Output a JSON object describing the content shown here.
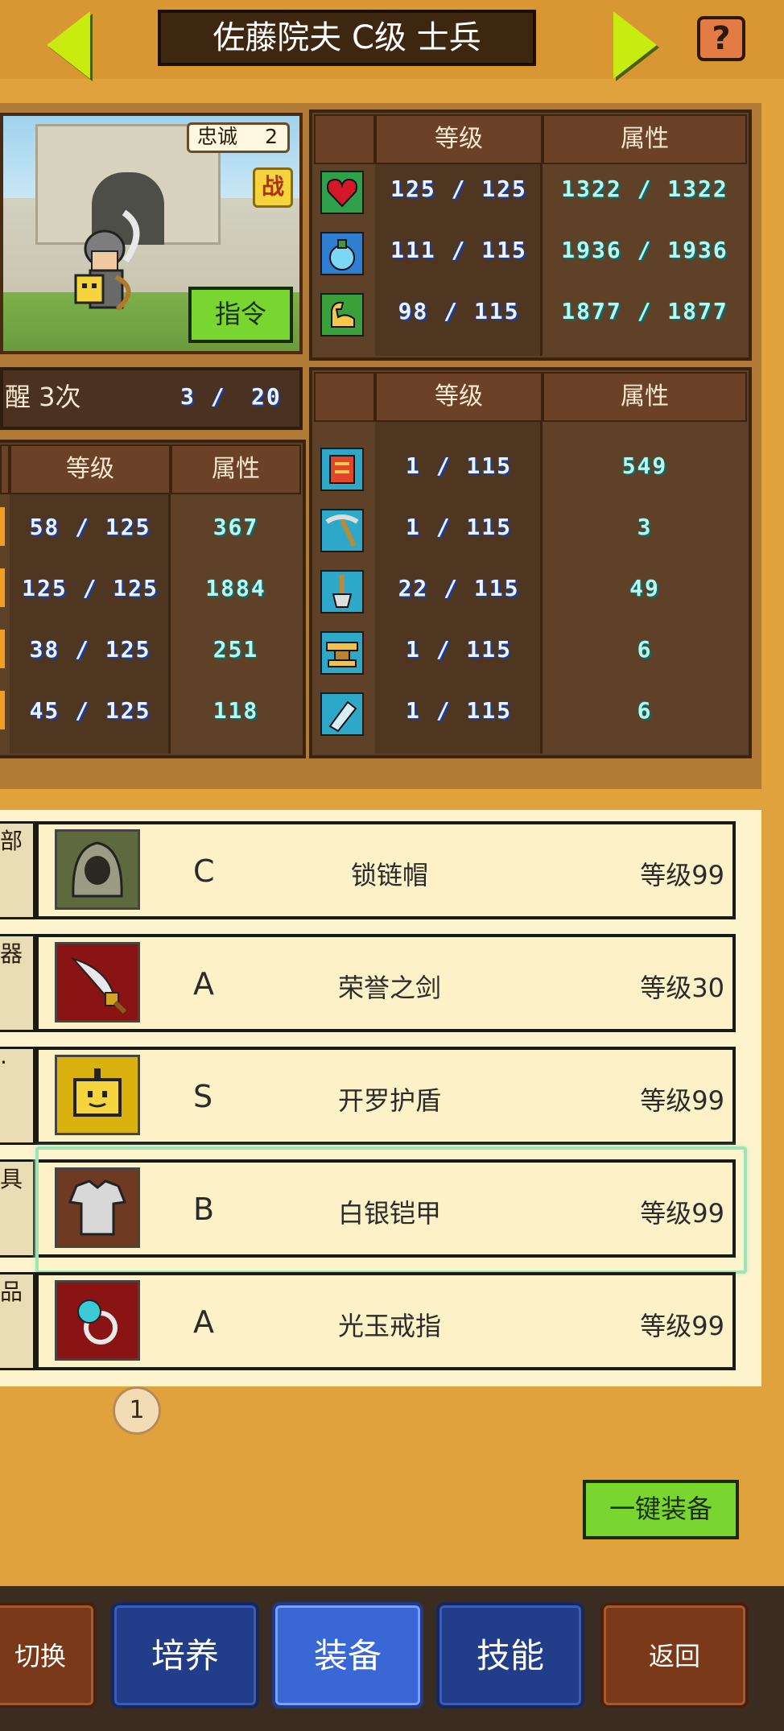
{
  "header": {
    "title": "佐藤院夫 C级 士兵",
    "help": "?"
  },
  "portrait": {
    "loyalty_label": "忠诚",
    "loyalty_value": "2",
    "battle_badge": "战",
    "command_button": "指令"
  },
  "awaken": {
    "label": "醒 3次",
    "progress": "3 /",
    "max": "20"
  },
  "base_stats": {
    "col_level": "等级",
    "col_attr": "属性",
    "rows": [
      {
        "icon": "heart-icon",
        "level": "125 / 125",
        "attr": "1322 / 1322"
      },
      {
        "icon": "mana-potion-icon",
        "level": "111 / 115",
        "attr": "1936 / 1936"
      },
      {
        "icon": "strength-arm-icon",
        "level": "98 / 115",
        "attr": "1877 / 1877"
      }
    ]
  },
  "combat_stats": {
    "col_level": "等级",
    "col_attr": "属性",
    "rows": [
      {
        "level": "58 / 125",
        "attr": "367"
      },
      {
        "level": "125 / 125",
        "attr": "1884"
      },
      {
        "level": "38 / 125",
        "attr": "251"
      },
      {
        "level": "45 / 125",
        "attr": "118"
      }
    ]
  },
  "work_stats": {
    "col_level": "等级",
    "col_attr": "属性",
    "rows": [
      {
        "icon": "book-icon",
        "level": "1 / 115",
        "attr": "549"
      },
      {
        "icon": "pickaxe-icon",
        "level": "1 / 115",
        "attr": "3"
      },
      {
        "icon": "shovel-icon",
        "level": "22 / 115",
        "attr": "49"
      },
      {
        "icon": "anvil-icon",
        "level": "1 / 115",
        "attr": "6"
      },
      {
        "icon": "bottle-icon",
        "level": "1 / 115",
        "attr": "6"
      }
    ]
  },
  "equipment": [
    {
      "slot": "部",
      "icon": "chain-hood-icon",
      "grade": "C",
      "name": "锁链帽",
      "level": "等级99",
      "bg": "#5e6a3e"
    },
    {
      "slot": "器",
      "icon": "sword-icon",
      "grade": "A",
      "name": "荣誉之剑",
      "level": "等级30",
      "bg": "#8a1414"
    },
    {
      "slot": "·",
      "icon": "kairo-shield-icon",
      "grade": "S",
      "name": "开罗护盾",
      "level": "等级99",
      "bg": "#d9b210"
    },
    {
      "slot": "具",
      "icon": "silver-armor-icon",
      "grade": "B",
      "name": "白银铠甲",
      "level": "等级99",
      "bg": "#6e3a22"
    },
    {
      "slot": "品",
      "icon": "ring-icon",
      "grade": "A",
      "name": "光玉戒指",
      "level": "等级99",
      "bg": "#8a1414"
    }
  ],
  "page_indicator": "1",
  "oneclick_equip": "一键装备",
  "bottom_tabs": {
    "switch": "切换",
    "train": "培养",
    "equip": "装备",
    "skill": "技能",
    "back": "返回"
  },
  "colors": {
    "accent_green": "#79d631",
    "active_tab": "#3a67d6",
    "tab_blue": "#223e8a",
    "panel_brown": "#5f4128"
  }
}
